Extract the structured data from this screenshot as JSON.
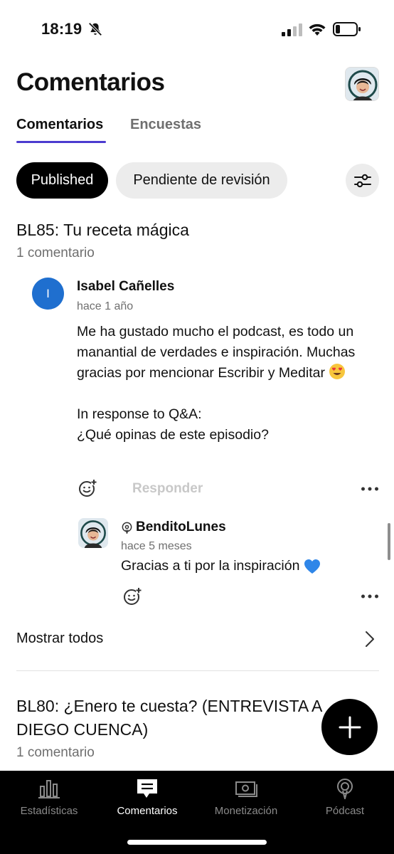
{
  "status_bar": {
    "time": "18:19",
    "icons": [
      "bell-off-icon",
      "signal-icon",
      "wifi-icon",
      "battery-icon"
    ]
  },
  "header": {
    "title": "Comentarios",
    "avatar_icon": "profile-avatar"
  },
  "tabs": [
    {
      "label": "Comentarios",
      "active": true
    },
    {
      "label": "Encuestas",
      "active": false
    }
  ],
  "filters": {
    "chips": [
      {
        "label": "Published",
        "selected": true
      },
      {
        "label": "Pendiente de revisión",
        "selected": false
      }
    ],
    "filter_icon": "sliders-icon"
  },
  "episodes": [
    {
      "title": "BL85: Tu receta mágica",
      "count": "1 comentario",
      "comment": {
        "avatar_initial": "I",
        "author": "Isabel Cañelles",
        "time": "hace 1 año",
        "body": "Me ha gustado mucho el podcast, es todo un manantial de verdades e inspiración. Muchas gracias por mencionar Escribir y Meditar",
        "emoji": "smiling-face-with-heart-eyes",
        "context_line1": "In response to Q&A:",
        "context_line2": "¿Qué opinas de este episodio?",
        "reply_label": "Responder"
      },
      "reply": {
        "author": "BenditoLunes",
        "time": "hace 5 meses",
        "body": "Gracias a ti por la inspiración",
        "emoji": "blue-heart"
      },
      "show_all": "Mostrar todos"
    },
    {
      "title": "BL80: ¿Enero te cuesta? (ENTREVISTA A DIEGO CUENCA)",
      "count": "1 comentario"
    }
  ],
  "fab_icon": "plus-icon",
  "bottom_nav": [
    {
      "label": "Estadísticas",
      "icon": "bar-chart-icon",
      "active": false
    },
    {
      "label": "Comentarios",
      "icon": "comment-icon",
      "active": true
    },
    {
      "label": "Monetización",
      "icon": "money-icon",
      "active": false
    },
    {
      "label": "Pódcast",
      "icon": "podcast-icon",
      "active": false
    }
  ],
  "colors": {
    "accent": "#4c3bcf",
    "avatar_blue": "#1f6fcf",
    "nav_bg": "#000000"
  }
}
